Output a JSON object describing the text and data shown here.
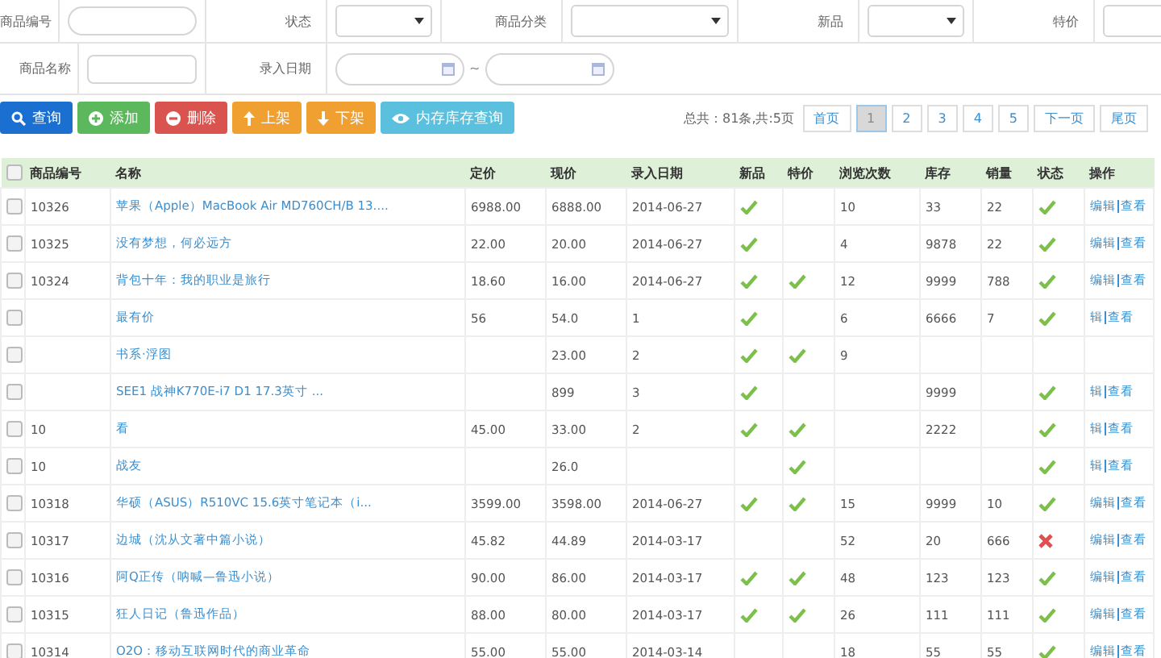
{
  "filters": [
    {
      "kind": "text",
      "label": "商品编号"
    },
    {
      "kind": "select",
      "label": "状态"
    },
    {
      "kind": "select",
      "label": "商品分类"
    },
    {
      "kind": "select",
      "label": "新品"
    },
    {
      "kind": "select",
      "label": "特价"
    }
  ],
  "filters2": [
    {
      "kind": "text",
      "label": "商品名称"
    },
    {
      "kind": "daterange",
      "label": "录入日期",
      "separator": "~"
    }
  ],
  "buttons": [
    "查询",
    "添加",
    "删除",
    "上架",
    "下架",
    "内存库存查询"
  ],
  "pagination": {
    "summary": "总共：81条,共:5页",
    "pages": [
      {
        "label": "首页",
        "selected": false
      },
      {
        "label": "1",
        "selected": true
      },
      {
        "label": "2",
        "selected": false
      },
      {
        "label": "3",
        "selected": false
      },
      {
        "label": "4",
        "selected": false
      },
      {
        "label": "5",
        "selected": false
      },
      {
        "label": "下一页",
        "selected": false
      },
      {
        "label": "尾页",
        "selected": false
      }
    ]
  },
  "table": {
    "select_all_checked": false,
    "columns": [
      "商品编号",
      "名称",
      "定价",
      "现价",
      "录入日期",
      "新品",
      "特价",
      "浏览次数",
      "库存",
      "销量",
      "状态",
      "操作"
    ],
    "rows": [
      {
        "checked": false,
        "id": "10326",
        "name": "苹果（Apple）MacBook Air MD760CH/B 13....",
        "price": "6988.00",
        "now": "6888.00",
        "date": "2014-06-27",
        "new": true,
        "special": false,
        "views": "10",
        "stock": "33",
        "sales": "22",
        "active": true,
        "ops": [
          "编辑",
          "查看"
        ]
      },
      {
        "checked": false,
        "id": "10325",
        "name": "没有梦想，何必远方",
        "price": "22.00",
        "now": "20.00",
        "date": "2014-06-27",
        "new": true,
        "special": false,
        "views": "4",
        "stock": "9878",
        "sales": "22",
        "active": true,
        "ops": [
          "编辑",
          "查看"
        ]
      },
      {
        "checked": false,
        "id": "10324",
        "name": "背包十年：我的职业是旅行",
        "price": "18.60",
        "now": "16.00",
        "date": "2014-06-27",
        "new": true,
        "special": true,
        "views": "12",
        "stock": "9999",
        "sales": "788",
        "active": true,
        "ops": [
          "编辑",
          "查看"
        ]
      },
      {
        "checked": false,
        "name": "最有价",
        "price": "56",
        "now": "54.0",
        "date": "1",
        "new": true,
        "special": false,
        "views": "6",
        "stock": "6666",
        "sales": "7",
        "active": true,
        "ops": [
          "辑",
          "查看"
        ]
      },
      {
        "checked": false,
        "name": "书系·浮图",
        "now": "23.00",
        "date": "2",
        "new": true,
        "special": true,
        "views": "9"
      },
      {
        "checked": false,
        "name": "SEE1 战神K770E-i7 D1 17.3英寸 ...",
        "now": "899",
        "date": "3",
        "new": true,
        "special": false,
        "stock": "9999",
        "active": true,
        "ops": [
          "辑",
          "查看"
        ]
      },
      {
        "checked": false,
        "id": "10",
        "name": "看",
        "price": "45.00",
        "now": "33.00",
        "date": "2",
        "new": true,
        "special": true,
        "stock": "2222",
        "active": true,
        "ops": [
          "辑",
          "查看"
        ]
      },
      {
        "checked": false,
        "id": "10",
        "name": "战友",
        "now": "26.0",
        "new": false,
        "special": true,
        "active": true,
        "ops": [
          "辑",
          "查看"
        ]
      },
      {
        "checked": false,
        "id": "10318",
        "name": "华硕（ASUS）R510VC 15.6英寸笔记本（i...",
        "price": "3599.00",
        "now": "3598.00",
        "date": "2014-06-27",
        "new": true,
        "special": true,
        "views": "15",
        "stock": "9999",
        "sales": "10",
        "active": true,
        "ops": [
          "编辑",
          "查看"
        ]
      },
      {
        "checked": false,
        "id": "10317",
        "name": "边城（沈从文著中篇小说）",
        "price": "45.82",
        "now": "44.89",
        "date": "2014-03-17",
        "new": false,
        "special": false,
        "views": "52",
        "stock": "20",
        "sales": "666",
        "active": false,
        "ops": [
          "编辑",
          "查看"
        ]
      },
      {
        "checked": false,
        "id": "10316",
        "name": "阿Q正传（呐喊—鲁迅小说）",
        "price": "90.00",
        "now": "86.00",
        "date": "2014-03-17",
        "new": true,
        "special": true,
        "views": "48",
        "stock": "123",
        "sales": "123",
        "active": true,
        "ops": [
          "编辑",
          "查看"
        ]
      },
      {
        "checked": false,
        "id": "10315",
        "name": "狂人日记（鲁迅作品）",
        "price": "88.00",
        "now": "80.00",
        "date": "2014-03-17",
        "new": true,
        "special": true,
        "views": "26",
        "stock": "111",
        "sales": "111",
        "active": true,
        "ops": [
          "编辑",
          "查看"
        ]
      },
      {
        "checked": false,
        "id": "10314",
        "name": "O2O：移动互联网时代的商业革命",
        "price": "55.00",
        "now": "55.00",
        "date": "2014-03-14",
        "new": false,
        "special": false,
        "views": "18",
        "stock": "55",
        "sales": "55",
        "active": true,
        "ops": [
          "编辑",
          "查看"
        ]
      }
    ]
  }
}
